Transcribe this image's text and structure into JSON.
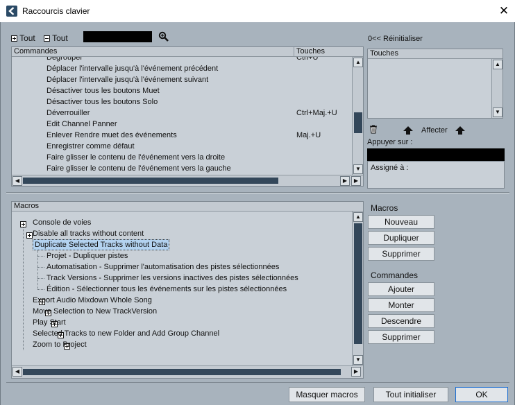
{
  "window": {
    "title": "Raccourcis clavier"
  },
  "toolbar": {
    "expand_all": "Tout",
    "collapse_all": "Tout",
    "reset_label": "0<< Réinitialiser"
  },
  "commands_panel": {
    "col_commands": "Commandes",
    "col_keys": "Touches",
    "rows": [
      {
        "command": "Dégrouper",
        "keys": "Ctrl+U"
      },
      {
        "command": "Déplacer l'intervalle jusqu'à l'événement précédent",
        "keys": ""
      },
      {
        "command": "Déplacer l'intervalle jusqu'à l'événement suivant",
        "keys": ""
      },
      {
        "command": "Désactiver tous les boutons Muet",
        "keys": ""
      },
      {
        "command": "Désactiver tous les boutons Solo",
        "keys": ""
      },
      {
        "command": "Déverrouiller",
        "keys": "Ctrl+Maj.+U"
      },
      {
        "command": "Edit Channel Panner",
        "keys": ""
      },
      {
        "command": "Enlever Rendre muet des événements",
        "keys": "Maj.+U"
      },
      {
        "command": "Enregistrer comme défaut",
        "keys": ""
      },
      {
        "command": "Faire glisser le contenu de l'événement vers la droite",
        "keys": ""
      },
      {
        "command": "Faire glisser le contenu de l'événement vers la gauche",
        "keys": ""
      }
    ]
  },
  "keys_panel": {
    "header": "Touches",
    "assign_label": "Affecter",
    "press_label": "Appuyer sur :",
    "assigned_label": "Assigné à :"
  },
  "macros_panel": {
    "header": "Macros",
    "items": [
      {
        "label": "Console de voies",
        "expanded": false,
        "selected": false
      },
      {
        "label": "Disable all tracks without content",
        "expanded": false,
        "selected": false
      },
      {
        "label": "Duplicate Selected Tracks without Data",
        "expanded": true,
        "selected": true
      },
      {
        "label": "Export Audio Mixdown Whole Song",
        "expanded": false,
        "selected": false
      },
      {
        "label": "Move Selection to New TrackVersion",
        "expanded": false,
        "selected": false
      },
      {
        "label": "Play Start",
        "expanded": false,
        "selected": false
      },
      {
        "label": "Selected Tracks to new Folder and Add Group Channel",
        "expanded": false,
        "selected": false
      },
      {
        "label": "Zoom to Project",
        "expanded": false,
        "selected": false
      }
    ],
    "children": [
      "Projet - Dupliquer pistes",
      "Automatisation - Supprimer l'automatisation des pistes sélectionnées",
      "Track Versions - Supprimer les versions inactives des pistes sélectionnées",
      "Édition - Sélectionner tous les événements sur les pistes sélectionnées"
    ]
  },
  "macros_buttons": {
    "heading": "Macros",
    "new": "Nouveau",
    "duplicate": "Dupliquer",
    "delete": "Supprimer"
  },
  "commands_buttons": {
    "heading": "Commandes",
    "add": "Ajouter",
    "up": "Monter",
    "down": "Descendre",
    "delete": "Supprimer"
  },
  "footer": {
    "hide_macros": "Masquer macros",
    "reset_all": "Tout initialiser",
    "ok": "OK"
  },
  "colors": {
    "accent": "#1e6fd0",
    "selection": "#b3d2f0",
    "scroll_thumb": "#33475a"
  }
}
